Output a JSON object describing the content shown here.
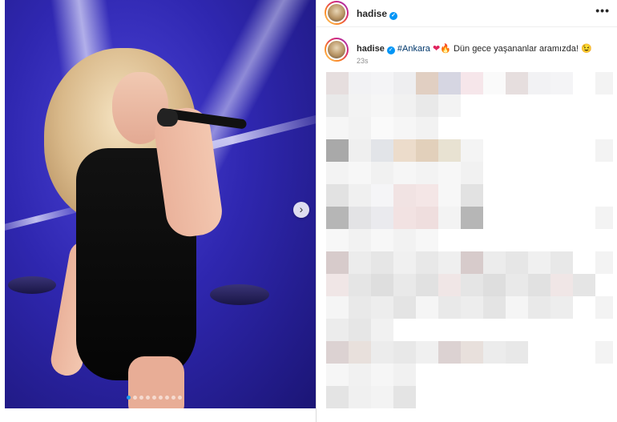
{
  "post": {
    "username": "hadise",
    "verified_glyph": "✓",
    "more_glyph": "•••",
    "caption": {
      "username": "hadise",
      "hashtag": "#Ankara",
      "heart": "❤",
      "fire": "🔥",
      "text": "Dün gece yaşananlar aramızda!",
      "emoji": "😉"
    },
    "time": "23s"
  },
  "carousel": {
    "next_glyph": "›",
    "slide_count": 9,
    "active_index": 0
  },
  "icons": [
    "verified-badge-icon",
    "more-options-icon",
    "chevron-right-icon"
  ],
  "colors": {
    "accent": "#0095f6",
    "hashtag": "#00376b",
    "stage_blue": "#2f27b0"
  }
}
